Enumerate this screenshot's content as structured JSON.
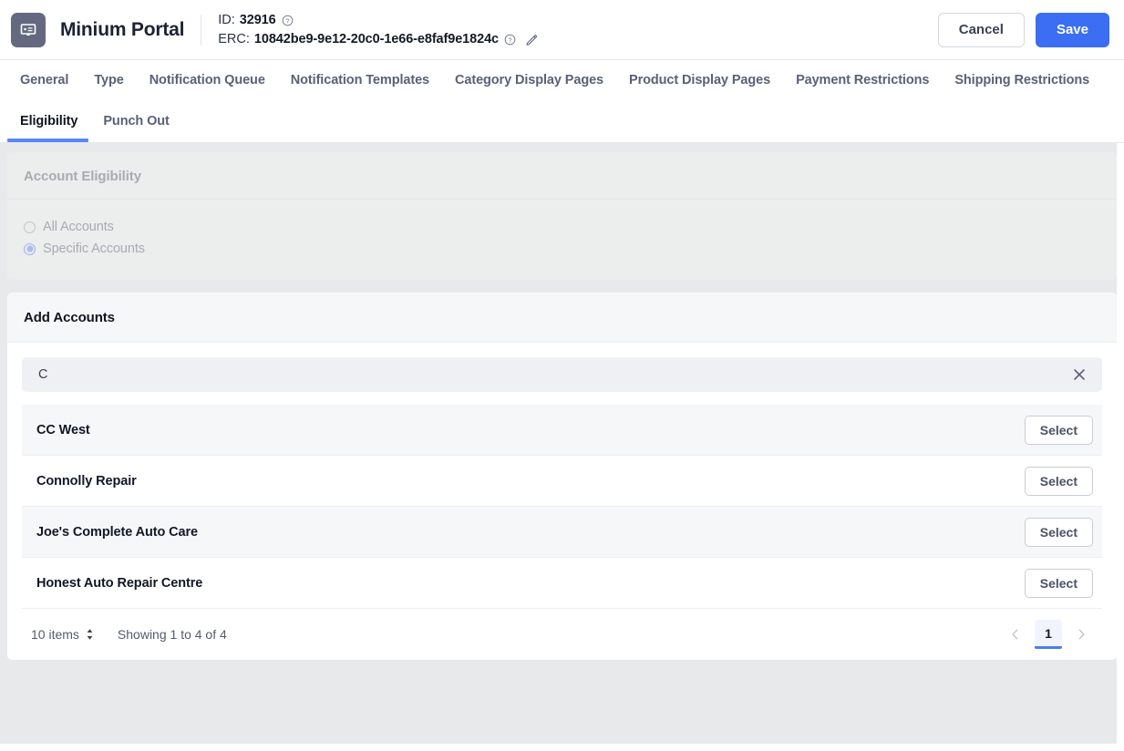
{
  "header": {
    "app_icon": "display-card-icon",
    "title": "Minium Portal",
    "id_label": "ID:",
    "id_value": "32916",
    "erc_label": "ERC:",
    "erc_value": "10842be9-9e12-20c0-1e66-e8faf9e1824c",
    "help_icon": "question-circle-icon",
    "edit_icon": "pencil-icon",
    "cancel_label": "Cancel",
    "save_label": "Save",
    "accent_color": "#3b6ef3"
  },
  "tabs": {
    "primary": [
      {
        "label": "General",
        "active": false
      },
      {
        "label": "Type",
        "active": false
      },
      {
        "label": "Notification Queue",
        "active": false
      },
      {
        "label": "Notification Templates",
        "active": false
      },
      {
        "label": "Category Display Pages",
        "active": false
      },
      {
        "label": "Product Display Pages",
        "active": false
      },
      {
        "label": "Payment Restrictions",
        "active": false
      },
      {
        "label": "Shipping Restrictions",
        "active": false
      }
    ],
    "secondary": [
      {
        "label": "Eligibility",
        "active": true
      },
      {
        "label": "Punch Out",
        "active": false
      }
    ],
    "active_underline_color": "#5b86f7"
  },
  "eligibility_card": {
    "title": "Account Eligibility",
    "disabled": true,
    "options": [
      {
        "label": "All Accounts",
        "selected": false
      },
      {
        "label": "Specific Accounts",
        "selected": true
      }
    ]
  },
  "add_accounts": {
    "title": "Add Accounts",
    "search": {
      "value": "C",
      "placeholder": "",
      "clear_icon": "close-x-icon"
    },
    "rows": [
      {
        "name": "CC West",
        "action_label": "Select"
      },
      {
        "name": "Connolly Repair",
        "action_label": "Select"
      },
      {
        "name": "Joe's Complete Auto Care",
        "action_label": "Select"
      },
      {
        "name": "Honest Auto Repair Centre",
        "action_label": "Select"
      }
    ],
    "footer": {
      "page_size_label": "10 items",
      "page_size_icon": "stepper-updown-icon",
      "showing_label": "Showing 1 to 4 of 4",
      "prev_icon": "chevron-left-icon",
      "next_icon": "chevron-right-icon",
      "current_page": "1",
      "page_accent_color": "#4a7df5"
    }
  }
}
